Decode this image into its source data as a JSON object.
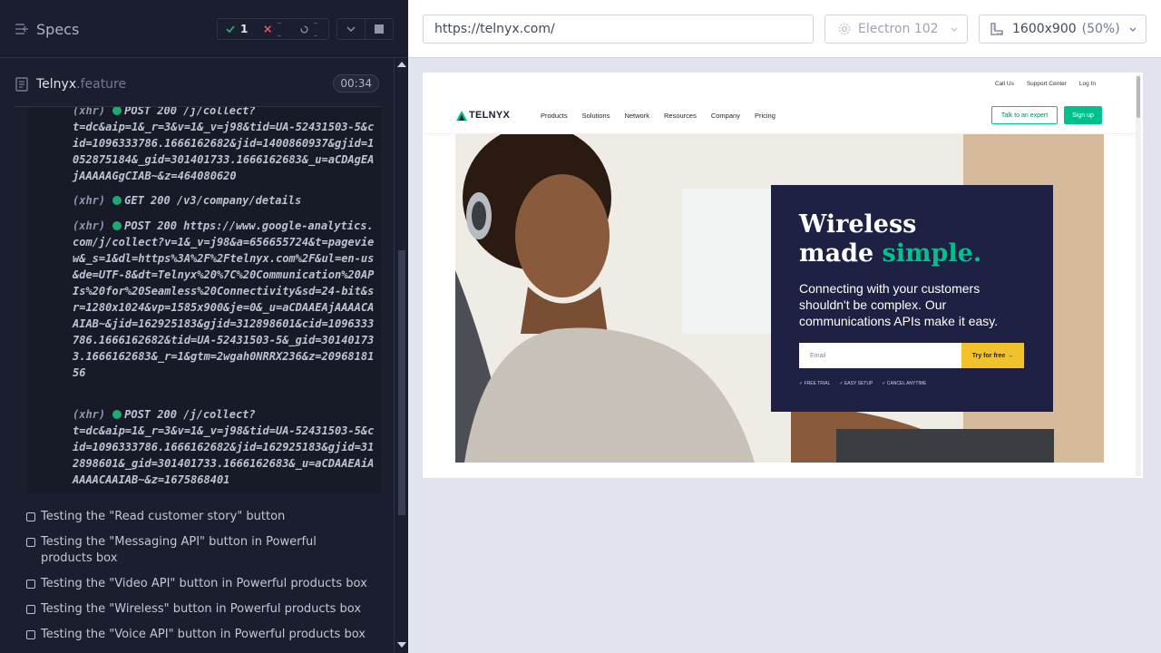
{
  "runner": {
    "title": "Specs",
    "stats": {
      "passed": "1",
      "failed": "--",
      "pending": "--"
    },
    "file": {
      "name": "Telnyx",
      "ext": ".feature",
      "duration": "00:34"
    },
    "logs": [
      {
        "tag": "(xhr)",
        "text": "POST 200 /j/collect?\nt=dc&aip=1&_r=3&v=1&_v=j98&tid=UA-52431503-5&cid=1096333786.1666162682&jid=1400860937&gjid=1052875184&_gid=301401733.1666162683&_u=aCDAgEAjAAAAAGgCIAB~&z=464080620"
      },
      {
        "tag": "(xhr)",
        "text": "GET 200 /v3/company/details"
      },
      {
        "tag": "(xhr)",
        "text": "POST 200 https://www.google-analytics.com/j/collect?v=1&_v=j98&a=656655724&t=pageview&_s=1&dl=https%3A%2F%2Ftelnyx.com%2F&ul=en-us&de=UTF-8&dt=Telnyx%20%7C%20Communication%20APIs%20for%20Seamless%20Connectivity&sd=24-bit&sr=1280x1024&vp=1585x900&je=0&_u=aCDAAEAjAAAACAAIAB~&jid=162925183&gjid=312898601&cid=1096333786.1666162682&tid=UA-52431503-5&_gid=301401733.1666162683&_r=1&gtm=2wgah0NRRX236&z=2096818156"
      },
      {
        "tag": "(xhr)",
        "text": "POST 200 /j/collect?\nt=dc&aip=1&_r=3&v=1&_v=j98&tid=UA-52431503-5&cid=1096333786.1666162682&jid=162925183&gjid=312898601&_gid=301401733.1666162683&_u=aCDAAEAiAAAAACAAIAB~&z=1675868401"
      }
    ],
    "tests": [
      "Testing the \"Read customer story\" button",
      "Testing the \"Messaging API\" button in Powerful products box",
      "Testing the \"Video API\" button in Powerful products box",
      "Testing the \"Wireless\" button in Powerful products box",
      "Testing the \"Voice API\" button in Powerful products box"
    ]
  },
  "aut_header": {
    "url": "https://telnyx.com/",
    "browser": "Electron 102",
    "viewport": "1600x900",
    "scale": "(50%)"
  },
  "site": {
    "topbar": [
      "Call Us",
      "Support Center",
      "Log In"
    ],
    "logo": "TELNYX",
    "nav": [
      "Products",
      "Solutions",
      "Network",
      "Resources",
      "Company",
      "Pricing"
    ],
    "cta_outline": "Talk to an expert",
    "cta_fill": "Sign up",
    "hero": {
      "line1": "Wireless",
      "line2a": "made ",
      "line2b": "simple.",
      "sub": "Connecting with your customers shouldn't be complex. Our communications APIs make it easy.",
      "email_placeholder": "Email",
      "try_label": "Try for free →",
      "badges": [
        "✓ FREE TRIAL",
        "✓ EASY SETUP",
        "✓ CANCEL ANYTIME"
      ]
    }
  },
  "colors": {
    "accent": "#00c08b",
    "pass": "#1fa971",
    "fail": "#e45770",
    "cta": "#f2c12e",
    "card": "#1e2044"
  }
}
